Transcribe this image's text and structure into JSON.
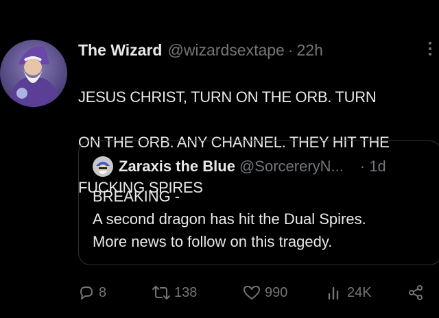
{
  "tweet": {
    "author_name": "The Wizard",
    "author_handle": "@wizardsextape",
    "separator": "·",
    "time": "22h",
    "text_lines": [
      "JESUS CHRIST, TURN ON THE ORB. TURN",
      "ON THE ORB. ANY CHANNEL. THEY HIT THE",
      "FUCKING SPIRES"
    ]
  },
  "quote": {
    "author_name": "Zaraxis the Blue",
    "author_handle": "@SorcereryN...",
    "time": "· 1d",
    "text_lines": [
      "BREAKING -",
      "A second dragon has hit the Dual Spires.",
      "More news to follow on this tragedy."
    ]
  },
  "actions": {
    "replies": "8",
    "retweets": "138",
    "likes": "990",
    "views": "24K"
  },
  "icons": {
    "reply": "reply-icon",
    "retweet": "retweet-icon",
    "like": "heart-icon",
    "views": "views-icon",
    "share": "share-icon",
    "more": "more-icon"
  }
}
